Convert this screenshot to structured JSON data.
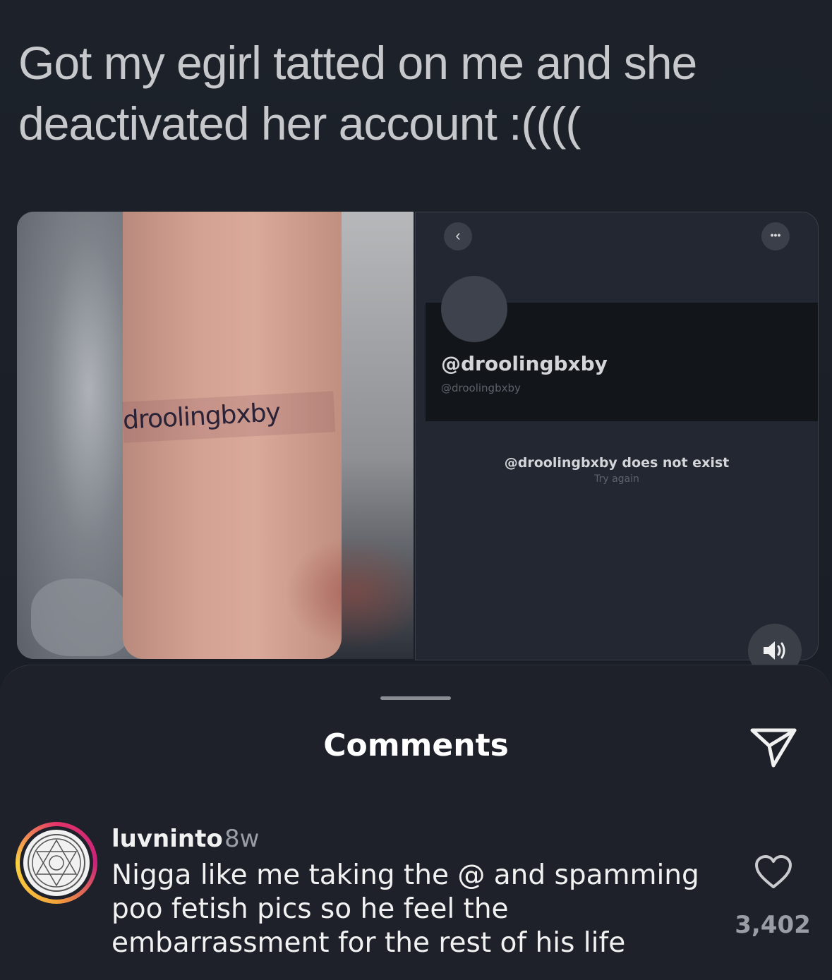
{
  "post": {
    "tweet_lines": [
      "Got my egirl tatted on me and she",
      "deactivated her account :(((("
    ],
    "tattoo_text": "droolingbxby",
    "screenshot": {
      "back_icon": "chevron-left-icon",
      "more_icon": "more-dots-icon",
      "handle": "@droolingbxby",
      "sub_handle": "@droolingbxby",
      "message": "@droolingbxby does not exist",
      "try_again": "Try again"
    },
    "sound_icon": "speaker-icon"
  },
  "sheet": {
    "title": "Comments",
    "send_icon": "send-icon"
  },
  "comment": {
    "username": "luvninto",
    "time": "8w",
    "body_lines": [
      "Nigga like me taking the @ and spamming",
      "poo fetish pics so he feel the",
      "embarrassment for the rest of his life"
    ],
    "likes": "3,402",
    "heart_icon": "heart-icon",
    "colors": {
      "ring_start": "#e4336a",
      "ring_end": "#fbd23f"
    }
  }
}
